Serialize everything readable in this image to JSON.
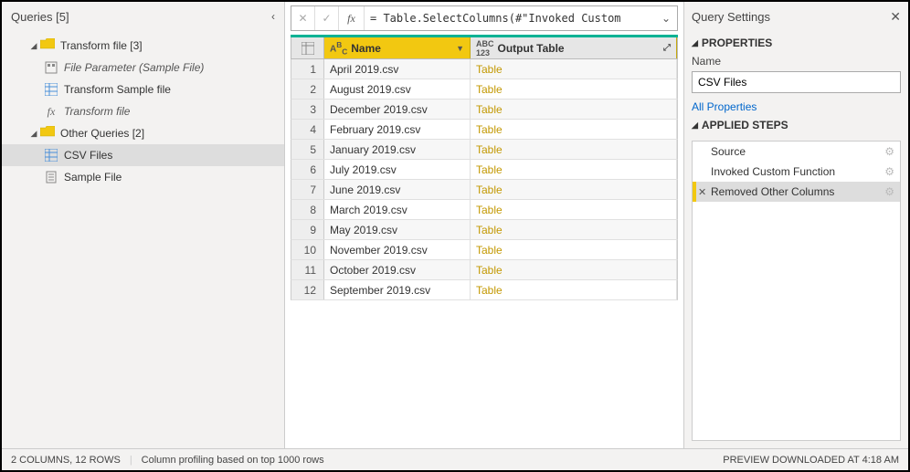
{
  "queries": {
    "header": "Queries [5]",
    "group1": {
      "label": "Transform file [3]"
    },
    "group1_items": {
      "param": "File Parameter (Sample File)",
      "sample": "Transform Sample file",
      "fn": "Transform file"
    },
    "group2": {
      "label": "Other Queries [2]"
    },
    "group2_items": {
      "csv": "CSV Files",
      "samplefile": "Sample File"
    }
  },
  "formula": {
    "text": "= Table.SelectColumns(#\"Invoked Custom"
  },
  "grid": {
    "col1": "Name",
    "col2": "Output Table",
    "rows": [
      {
        "n": "1",
        "name": "April 2019.csv",
        "out": "Table"
      },
      {
        "n": "2",
        "name": "August 2019.csv",
        "out": "Table"
      },
      {
        "n": "3",
        "name": "December 2019.csv",
        "out": "Table"
      },
      {
        "n": "4",
        "name": "February 2019.csv",
        "out": "Table"
      },
      {
        "n": "5",
        "name": "January 2019.csv",
        "out": "Table"
      },
      {
        "n": "6",
        "name": "July 2019.csv",
        "out": "Table"
      },
      {
        "n": "7",
        "name": "June 2019.csv",
        "out": "Table"
      },
      {
        "n": "8",
        "name": "March 2019.csv",
        "out": "Table"
      },
      {
        "n": "9",
        "name": "May 2019.csv",
        "out": "Table"
      },
      {
        "n": "10",
        "name": "November 2019.csv",
        "out": "Table"
      },
      {
        "n": "11",
        "name": "October 2019.csv",
        "out": "Table"
      },
      {
        "n": "12",
        "name": "September 2019.csv",
        "out": "Table"
      }
    ]
  },
  "settings": {
    "header": "Query Settings",
    "properties": "PROPERTIES",
    "name_label": "Name",
    "name_value": "CSV Files",
    "all_props": "All Properties",
    "applied": "APPLIED STEPS",
    "steps": {
      "s1": "Source",
      "s2": "Invoked Custom Function",
      "s3": "Removed Other Columns"
    }
  },
  "status": {
    "left1": "2 COLUMNS, 12 ROWS",
    "left2": "Column profiling based on top 1000 rows",
    "right": "PREVIEW DOWNLOADED AT 4:18 AM"
  }
}
